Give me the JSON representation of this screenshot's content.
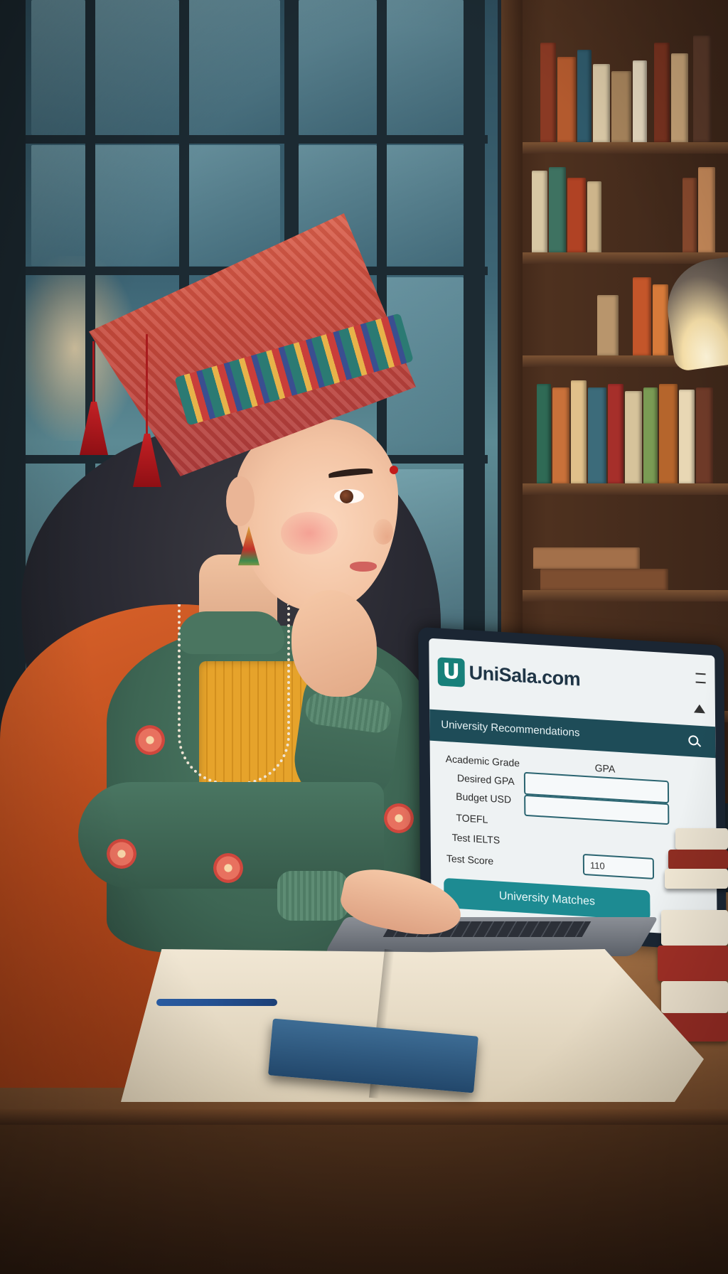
{
  "laptop_screen": {
    "site_name": "UniSala.com",
    "logo_letter": "U",
    "banner_title": "University Recommendations",
    "form": {
      "labels": [
        "Academic Grade",
        "Desired GPA",
        "Budget USD",
        "TOEFL",
        "Test IELTS",
        "Test Score"
      ],
      "gpa_placeholder": "GPA",
      "score_value": "110"
    },
    "submit_label": "University Matches"
  }
}
